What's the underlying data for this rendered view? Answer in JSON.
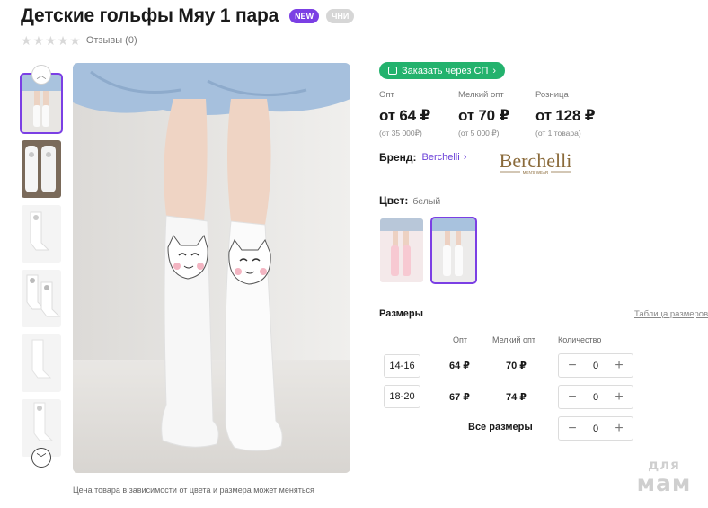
{
  "product": {
    "title": "Детские гольфы Мяу 1 пара",
    "badges": {
      "new": "NEW",
      "chn": "ЧНИ"
    },
    "rating_stars": 0,
    "reviews_label": "Отзывы (0)"
  },
  "gallery": {
    "price_note": "Цена товара в зависимости от цвета и размера может меняться"
  },
  "order": {
    "sp_button_label": "Заказать через СП",
    "sp_button_chevron": "›",
    "prices": [
      {
        "label": "Опт",
        "value": "от 64 ₽",
        "sub": "(от 35 000₽)"
      },
      {
        "label": "Мелкий опт",
        "value": "от 70 ₽",
        "sub": "(от 5 000 ₽)"
      },
      {
        "label": "Розница",
        "value": "от 128 ₽",
        "sub": "(от 1 товара)"
      }
    ]
  },
  "brand": {
    "label": "Бренд:",
    "link": "Berchelli",
    "chevron": "›",
    "logo_text": "Berchelli",
    "logo_subtext": "MEN'S WEAR"
  },
  "color": {
    "label": "Цвет:",
    "value": "белый"
  },
  "sizes": {
    "title": "Размеры",
    "table_link": "Таблица размеров",
    "headers": {
      "opt": "Опт",
      "small_opt": "Мелкий опт",
      "qty": "Количество"
    },
    "rows": [
      {
        "size": "14-16",
        "opt": "64 ₽",
        "small_opt": "70 ₽",
        "qty": "0"
      },
      {
        "size": "18-20",
        "opt": "67 ₽",
        "small_opt": "74 ₽",
        "qty": "0"
      }
    ],
    "all_sizes_label": "Все размеры",
    "all_sizes_qty": "0",
    "minus": "−",
    "plus": "+"
  },
  "watermark": {
    "line1": "для",
    "line2": "мам"
  },
  "colors": {
    "accent": "#7b3fe4",
    "sp_green": "#23b26d",
    "link": "#6a3fd8"
  }
}
